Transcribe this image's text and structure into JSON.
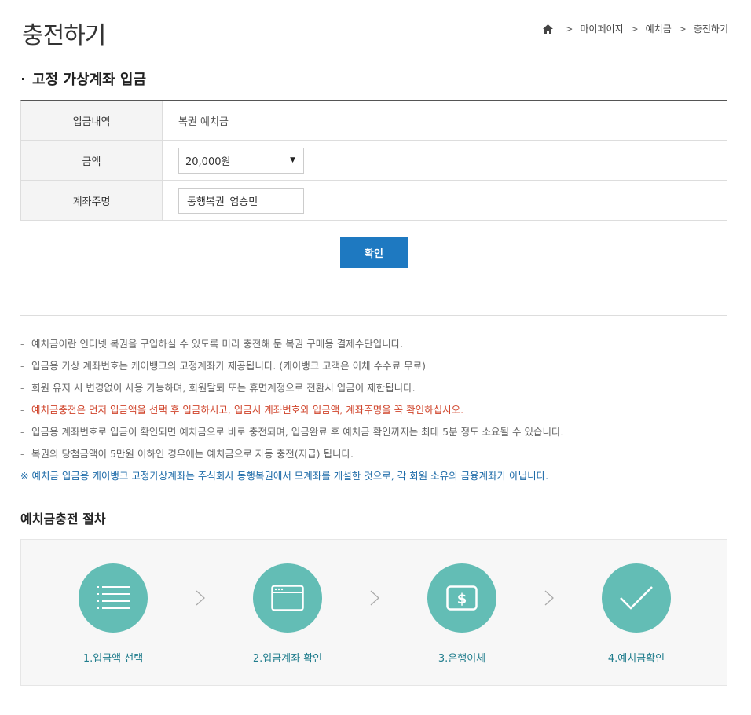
{
  "header": {
    "title": "충전하기",
    "breadcrumb": [
      "마이페이지",
      "예치금",
      "충전하기"
    ]
  },
  "section": {
    "title": "고정 가상계좌 입금"
  },
  "form": {
    "rows": [
      {
        "label": "입금내역",
        "value": "복권 예치금"
      },
      {
        "label": "금액",
        "value": "20,000원"
      },
      {
        "label": "계좌주명",
        "value": "동행복권_염승민"
      }
    ],
    "confirm_label": "확인"
  },
  "notes": [
    "예치금이란 인터넷 복권을 구입하실 수 있도록 미리 충전해 둔 복권 구매용 결제수단입니다.",
    "입금용 가상 계좌번호는 케이뱅크의 고정계좌가 제공됩니다. (케이뱅크 고객은 이체 수수료 무료)",
    "회원 유지 시 변경없이 사용 가능하며, 회원탈퇴 또는 휴면계정으로 전환시 입금이 제한됩니다.",
    "예치금충전은 먼저 입금액을 선택 후 입금하시고, 입금시 계좌번호와 입금액, 계좌주명을 꼭 확인하십시오.",
    "입금용 계좌번호로 입금이 확인되면 예치금으로 바로 충전되며, 입금완료 후 예치금 확인까지는 최대 5분 정도 소요될 수 있습니다.",
    "복권의 당첨금액이 5만원 이하인 경우에는 예치금으로 자동 충전(지급) 됩니다."
  ],
  "notice": "※ 예치금 입금용 케이뱅크 고정가상계좌는 주식회사 동행복권에서 모계좌를 개설한 것으로, 각 회원 소유의 금융계좌가 아닙니다.",
  "process": {
    "title": "예치금충전 절차",
    "steps": [
      {
        "label": "1.입금액 선택",
        "icon": "list-icon"
      },
      {
        "label": "2.입금계좌 확인",
        "icon": "browser-window-icon"
      },
      {
        "label": "3.은행이체",
        "icon": "dollar-bill-icon"
      },
      {
        "label": "4.예치금확인",
        "icon": "checkmark-icon"
      }
    ]
  },
  "colors": {
    "accent_button": "#1e79c1",
    "step_circle": "#63bdb5",
    "warning_text": "#d0452c",
    "notice_text": "#1e6ba8"
  }
}
